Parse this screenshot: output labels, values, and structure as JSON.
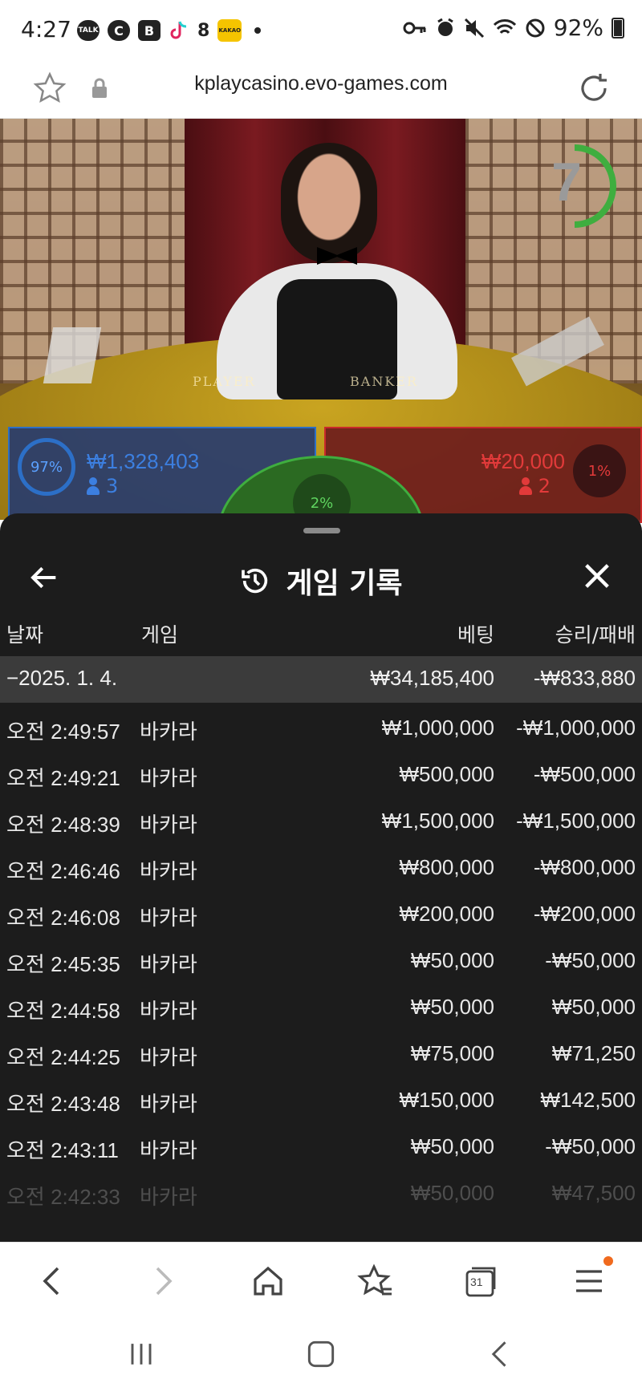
{
  "status_bar": {
    "time": "4:27",
    "notification_icons": [
      "TALK",
      "C",
      "B",
      "tiktok-icon",
      "8",
      "KAKAO"
    ],
    "battery": "92%"
  },
  "browser": {
    "url": "kplaycasino.evo-games.com"
  },
  "game": {
    "timer": "7",
    "player": {
      "percent": "97%",
      "amount": "₩1,328,403",
      "players": "3",
      "color": "#2c6fc7"
    },
    "tie": {
      "percent": "2%",
      "color": "#3fae3f"
    },
    "banker": {
      "percent": "1%",
      "amount": "₩20,000",
      "players": "2",
      "color": "#c92a2a"
    },
    "table_labels": {
      "player": "PLAYER",
      "banker": "BANKER"
    }
  },
  "history": {
    "title": "게임 기록",
    "columns": {
      "date": "날짜",
      "game": "게임",
      "bet": "베팅",
      "win_loss": "승리/패배"
    },
    "summary": {
      "date": "−2025. 1. 4.",
      "bet": "₩34,185,400",
      "win_loss": "-₩833,880"
    },
    "rows": [
      {
        "time": "오전 2:49:57",
        "game": "바카라",
        "bet": "₩1,000,000",
        "result": "-₩1,000,000"
      },
      {
        "time": "오전 2:49:21",
        "game": "바카라",
        "bet": "₩500,000",
        "result": "-₩500,000"
      },
      {
        "time": "오전 2:48:39",
        "game": "바카라",
        "bet": "₩1,500,000",
        "result": "-₩1,500,000"
      },
      {
        "time": "오전 2:46:46",
        "game": "바카라",
        "bet": "₩800,000",
        "result": "-₩800,000"
      },
      {
        "time": "오전 2:46:08",
        "game": "바카라",
        "bet": "₩200,000",
        "result": "-₩200,000"
      },
      {
        "time": "오전 2:45:35",
        "game": "바카라",
        "bet": "₩50,000",
        "result": "-₩50,000"
      },
      {
        "time": "오전 2:44:58",
        "game": "바카라",
        "bet": "₩50,000",
        "result": "₩50,000"
      },
      {
        "time": "오전 2:44:25",
        "game": "바카라",
        "bet": "₩75,000",
        "result": "₩71,250"
      },
      {
        "time": "오전 2:43:48",
        "game": "바카라",
        "bet": "₩150,000",
        "result": "₩142,500"
      },
      {
        "time": "오전 2:43:11",
        "game": "바카라",
        "bet": "₩50,000",
        "result": "-₩50,000"
      },
      {
        "time": "오전 2:42:33",
        "game": "바카라",
        "bet": "₩50,000",
        "result": "₩47,500"
      }
    ]
  },
  "bottom_nav": {
    "items": [
      "back-icon",
      "forward-icon",
      "home-icon",
      "bookmarks-icon",
      "tabs-icon",
      "menu-icon"
    ],
    "tabs_count": "31"
  }
}
